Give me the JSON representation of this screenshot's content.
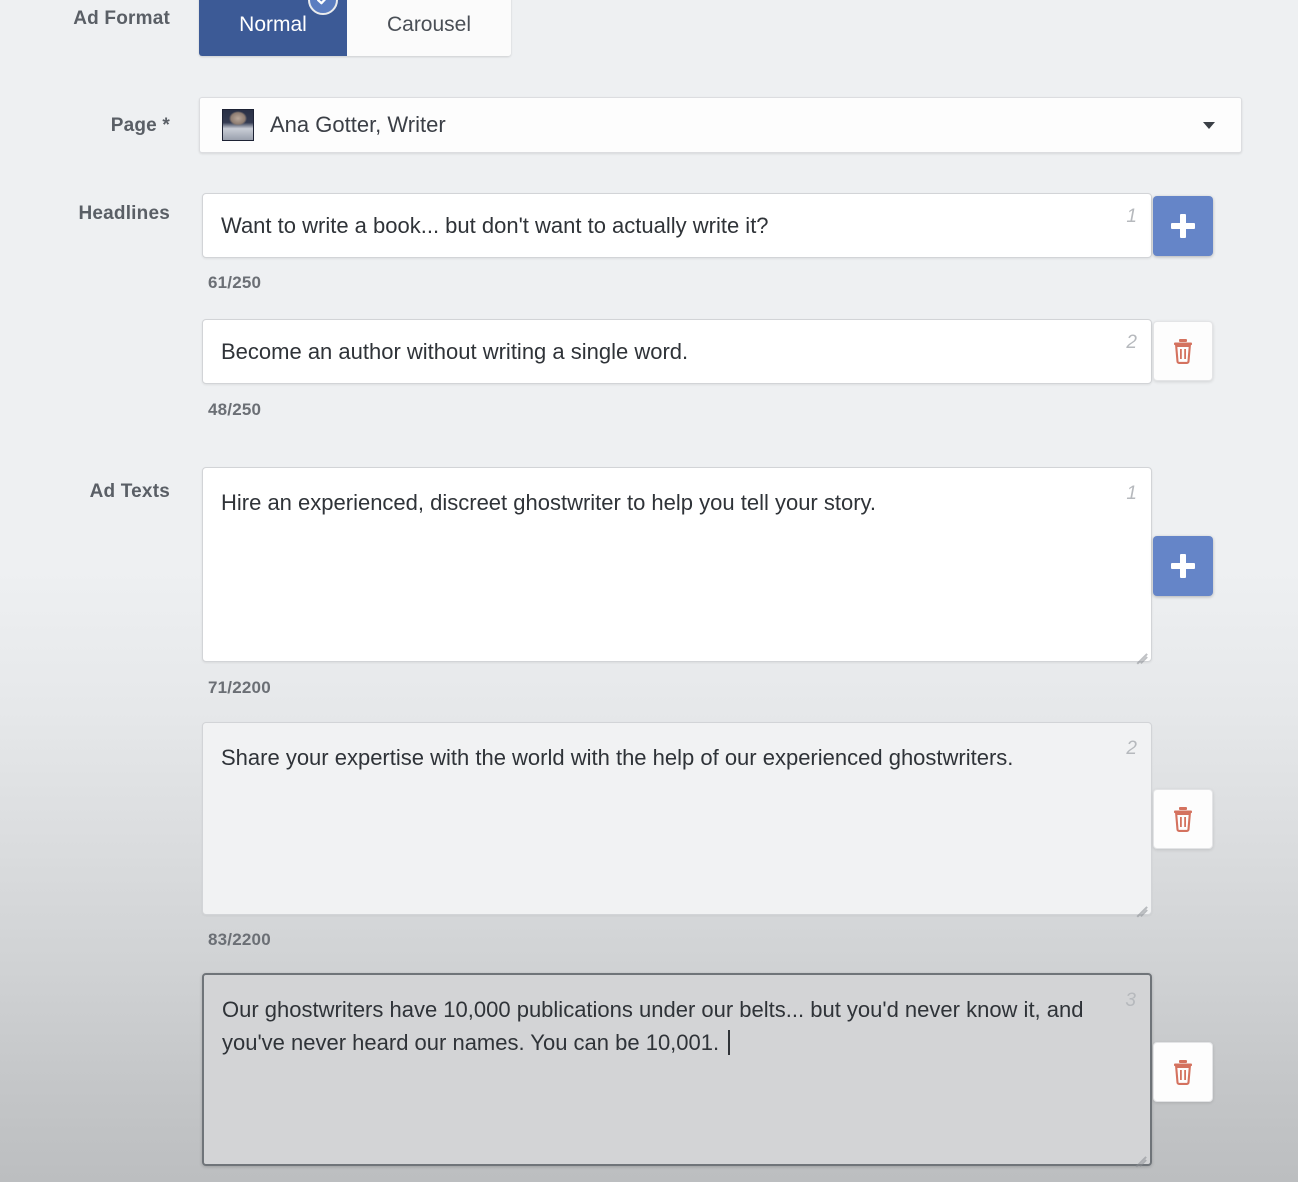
{
  "form": {
    "ad_format": {
      "label": "Ad Format",
      "tabs": [
        {
          "label": "Normal",
          "selected": true
        },
        {
          "label": "Carousel",
          "selected": false
        }
      ],
      "selected_badge_icon": "check-circle-icon"
    },
    "page": {
      "label": "Page *",
      "selected_value": "Ana Gotter, Writer",
      "avatar_icon": "page-avatar-image",
      "caret_icon": "chevron-down-icon"
    },
    "headlines": {
      "label": "Headlines",
      "items": [
        {
          "index": "1",
          "value": "Want to write a book... but don't want to actually write it?",
          "counter": "61/250",
          "action": "add",
          "action_label": "+",
          "action_icon": "plus-icon"
        },
        {
          "index": "2",
          "value": "Become an author without writing a single word.",
          "counter": "48/250",
          "action": "remove",
          "action_icon": "trash-icon"
        }
      ]
    },
    "ad_texts": {
      "label": "Ad Texts",
      "items": [
        {
          "index": "1",
          "value": "Hire an experienced, discreet ghostwriter to help you tell your story.",
          "counter": "71/2200",
          "action": "add",
          "action_label": "+",
          "action_icon": "plus-icon",
          "focused": false
        },
        {
          "index": "2",
          "value": "Share your expertise with the world with the help of our experienced ghostwriters.",
          "counter": "83/2200",
          "action": "remove",
          "action_icon": "trash-icon",
          "focused": false
        },
        {
          "index": "3",
          "value": "Our ghostwriters have 10,000 publications under our belts... but you'd never know it, and you've never heard our names. You can be 10,001. ",
          "counter": "",
          "action": "remove",
          "action_icon": "trash-icon",
          "focused": true
        }
      ]
    }
  },
  "colors": {
    "tab_active_bg": "#3c5a96",
    "add_button_bg": "#6585c8",
    "trash_icon": "#d4725f",
    "badge_bg": "#5b7dc0",
    "label_text": "#5a5f66"
  }
}
